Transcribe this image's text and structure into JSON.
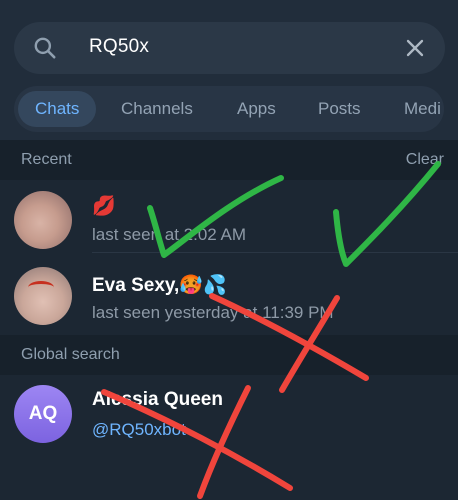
{
  "search": {
    "query": "RQ50x",
    "icon": "search-icon",
    "clear_icon": "close-icon"
  },
  "tabs": [
    {
      "label": "Chats",
      "active": true
    },
    {
      "label": "Channels",
      "active": false
    },
    {
      "label": "Apps",
      "active": false
    },
    {
      "label": "Posts",
      "active": false
    },
    {
      "label": "Medi",
      "active": false
    }
  ],
  "recent": {
    "title": "Recent",
    "action": "Clear",
    "items": [
      {
        "name": "💋",
        "status": "last seen at 2:02 AM"
      },
      {
        "name": "Eva Sexy,🥵💦",
        "status": "last seen yesterday at 11:39 PM"
      }
    ]
  },
  "global": {
    "title": "Global search",
    "items": [
      {
        "initials": "AQ",
        "name": "Alessia Queen",
        "username": "@RQ50xbot"
      }
    ]
  },
  "colors": {
    "background": "#1c2733",
    "accent": "#6fb5ff",
    "check_mark": "#2fb646",
    "cross_mark": "#f0453c"
  }
}
